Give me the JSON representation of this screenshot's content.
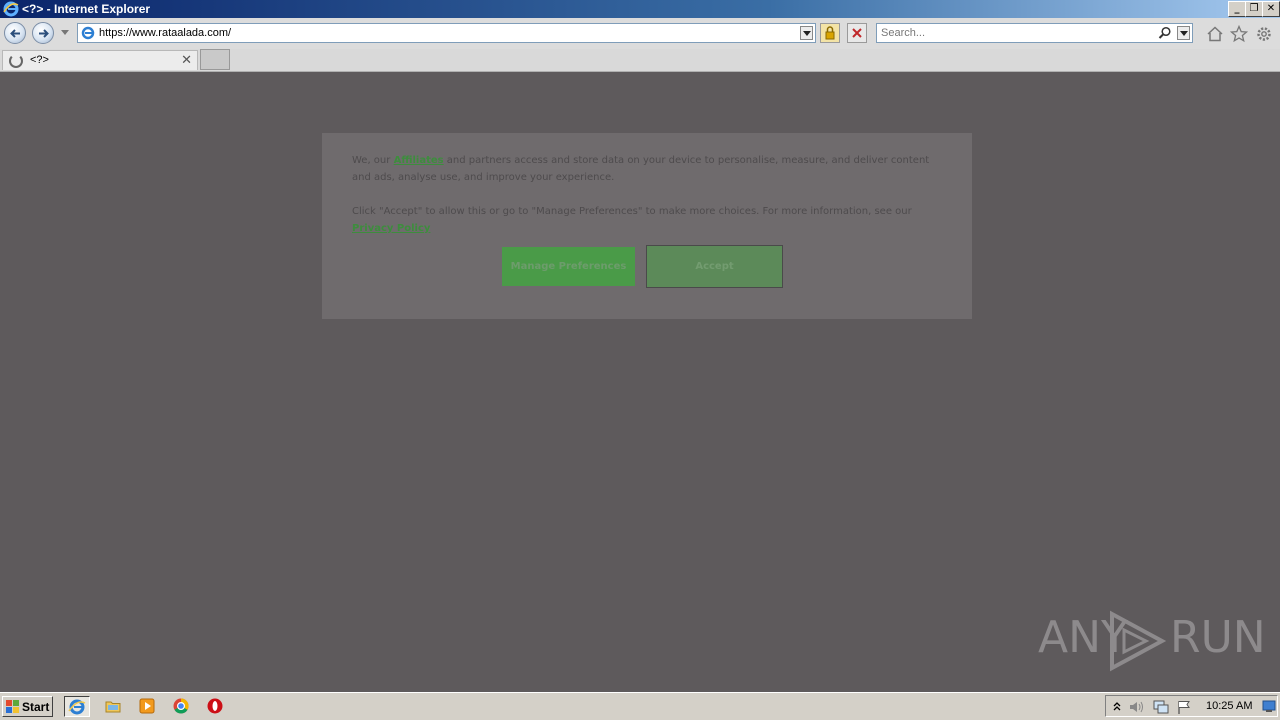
{
  "window": {
    "title": "<?> - Internet Explorer",
    "controls": [
      "minimize",
      "restore",
      "close"
    ]
  },
  "toolbar": {
    "url": "https://www.rataalada.com/",
    "search_placeholder": "Search..."
  },
  "tabs": [
    {
      "label": "<?>",
      "loading": true
    }
  ],
  "consent": {
    "p1_before": "We, our",
    "p1_link": "Affiliates",
    "p1_after": "and partners access and store data on your device to personalise, measure, and deliver content and ads, analyse use, and improve your experience.",
    "p2_before": "Click \"Accept\" to allow this or go to \"Manage Preferences\" to make more choices. For more information, see our",
    "p2_link": "Privacy Policy",
    "manage_label": "Manage Preferences",
    "accept_label": "Accept"
  },
  "watermark": {
    "left": "ANY",
    "right": "RUN"
  },
  "taskbar": {
    "start_label": "Start",
    "apps": [
      "internet-explorer",
      "file-explorer",
      "media-player",
      "chrome",
      "opera"
    ],
    "clock": "10:25 AM"
  },
  "colors": {
    "overlay": "#5e5a5c",
    "accent_green": "#4a9b48",
    "titlebar": "#0a246a"
  }
}
